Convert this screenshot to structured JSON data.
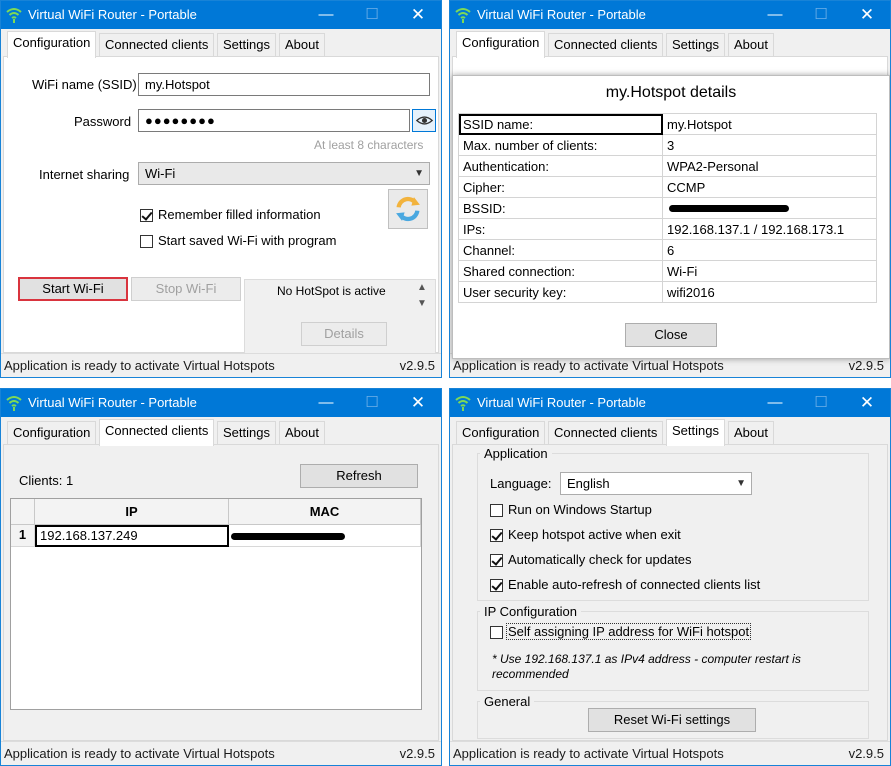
{
  "window_title": "Virtual WiFi Router - Portable",
  "tabs": [
    "Configuration",
    "Connected clients",
    "Settings",
    "About"
  ],
  "status_text": "Application is ready to activate Virtual Hotspots",
  "version": "v2.9.5",
  "config": {
    "ssid_label": "WiFi name (SSID)",
    "ssid_value": "my.Hotspot",
    "password_label": "Password",
    "password_value": "●●●●●●●●",
    "password_hint": "At least 8 characters",
    "sharing_label": "Internet sharing",
    "sharing_value": "Wi-Fi",
    "remember_label": "Remember filled information",
    "start_saved_label": "Start saved Wi-Fi with program",
    "start_button": "Start Wi-Fi",
    "stop_button": "Stop Wi-Fi",
    "hotspot_status": "No HotSpot is active",
    "details_button": "Details"
  },
  "details": {
    "title": "my.Hotspot details",
    "rows": [
      {
        "key": "SSID name:",
        "value": "my.Hotspot"
      },
      {
        "key": "Max. number of clients:",
        "value": "3"
      },
      {
        "key": "Authentication:",
        "value": "WPA2-Personal"
      },
      {
        "key": "Cipher:",
        "value": "CCMP"
      },
      {
        "key": "BSSID:",
        "value": ""
      },
      {
        "key": "IPs:",
        "value": "192.168.137.1 / 192.168.173.1"
      },
      {
        "key": "Channel:",
        "value": "6"
      },
      {
        "key": "Shared connection:",
        "value": "Wi-Fi"
      },
      {
        "key": "User security key:",
        "value": "wifi2016"
      }
    ],
    "close_button": "Close"
  },
  "clients": {
    "count_label": "Clients: 1",
    "refresh_button": "Refresh",
    "columns": [
      "IP",
      "MAC"
    ],
    "rows": [
      {
        "num": "1",
        "ip": "192.168.137.249",
        "mac": ""
      }
    ]
  },
  "settings": {
    "application_group": "Application",
    "language_label": "Language:",
    "language_value": "English",
    "run_startup": "Run on Windows Startup",
    "keep_active": "Keep hotspot active when exit",
    "auto_update": "Automatically check for updates",
    "auto_refresh": "Enable auto-refresh of connected clients list",
    "ip_group": "IP Configuration",
    "self_assign": "Self assigning IP address for WiFi hotspot",
    "ip_note": "* Use 192.168.137.1 as IPv4 address - computer restart is recommended",
    "general_group": "General",
    "reset_button": "Reset Wi-Fi settings"
  },
  "checks": {
    "remember": true,
    "start_saved": false,
    "run_startup": false,
    "keep_active": true,
    "auto_update": true,
    "auto_refresh": true,
    "self_assign": false
  },
  "colors": {
    "titlebar": "#0078d7",
    "focus_border": "#d9343e"
  }
}
